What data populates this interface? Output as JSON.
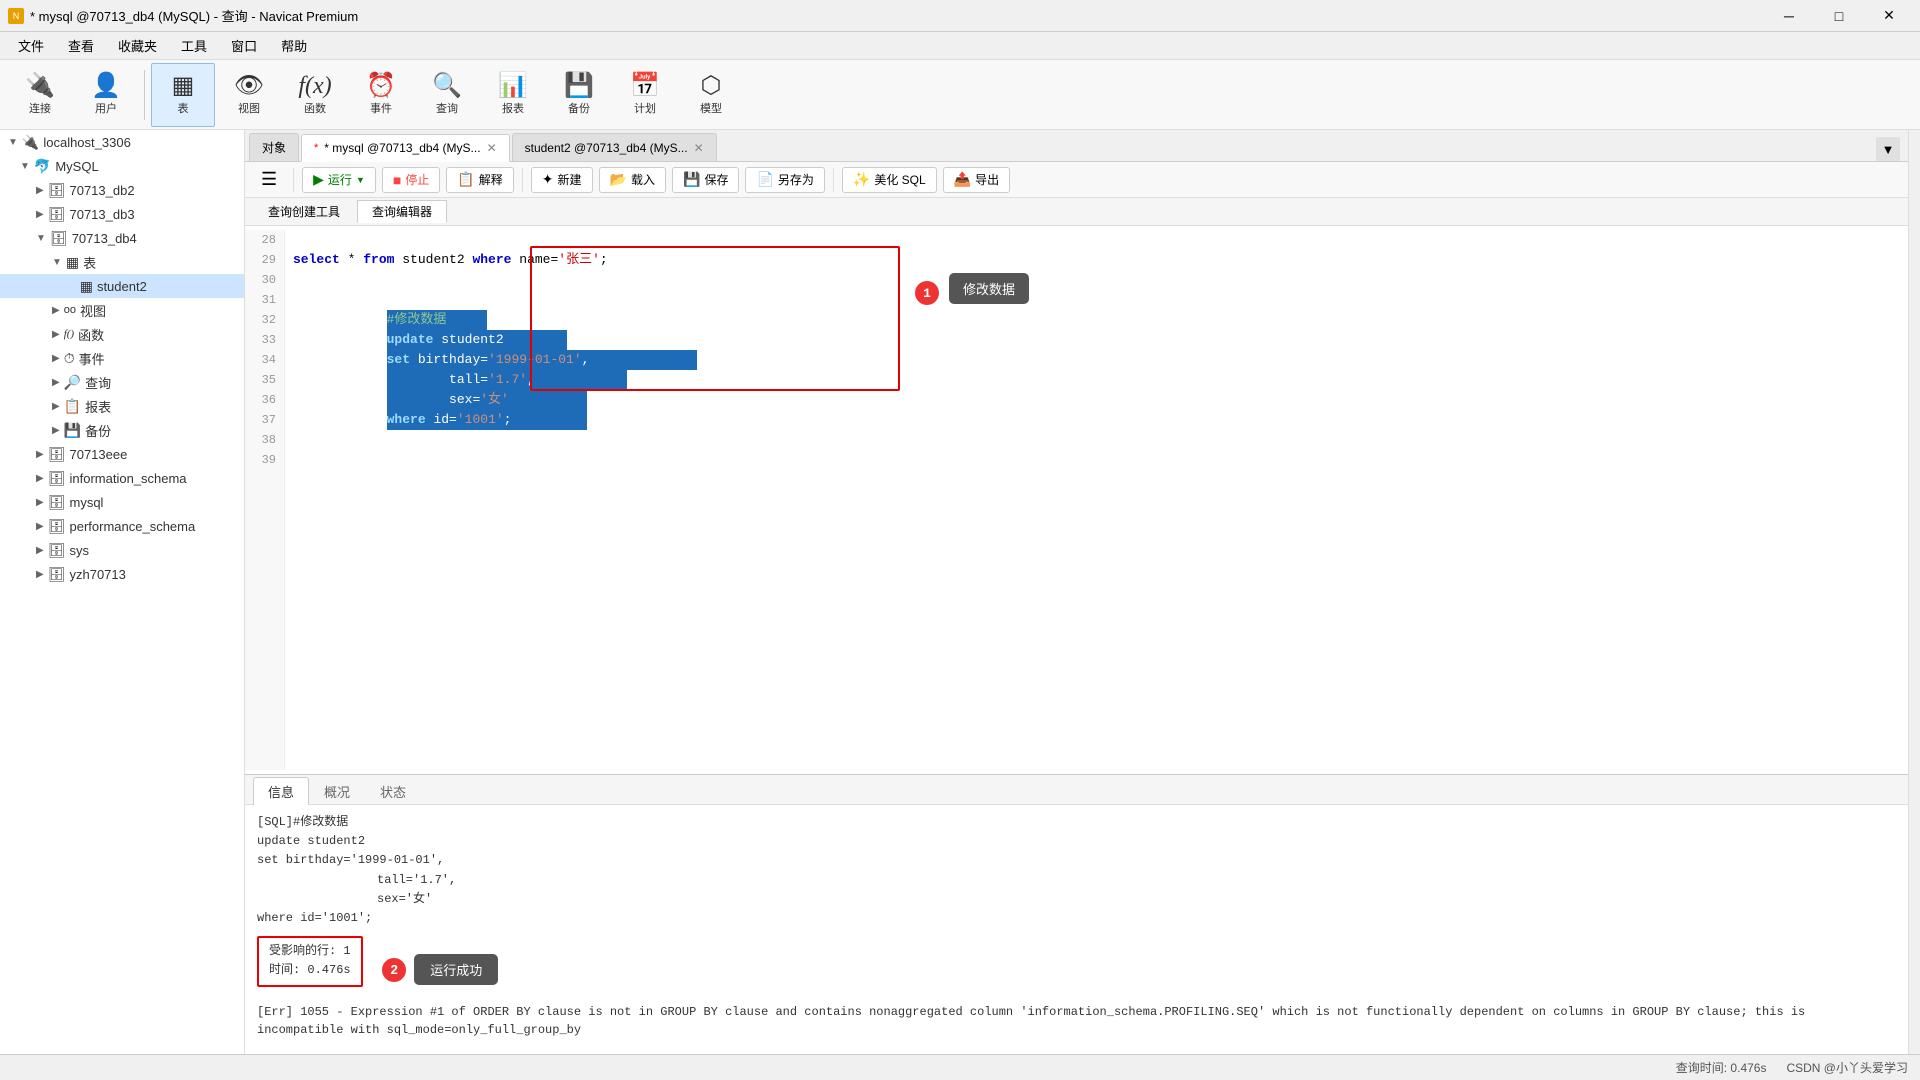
{
  "titlebar": {
    "title": "* mysql @70713_db4 (MySQL) - 查询 - Navicat Premium",
    "icon": "N"
  },
  "menubar": {
    "items": [
      "文件",
      "查看",
      "收藏夹",
      "工具",
      "窗口",
      "帮助"
    ]
  },
  "toolbar": {
    "items": [
      {
        "label": "连接",
        "icon": "🔌"
      },
      {
        "label": "用户",
        "icon": "👤"
      },
      {
        "label": "表",
        "icon": "▦"
      },
      {
        "label": "视图",
        "icon": "👁"
      },
      {
        "label": "函数",
        "icon": "ƒ"
      },
      {
        "label": "事件",
        "icon": "⏰"
      },
      {
        "label": "查询",
        "icon": "🔍"
      },
      {
        "label": "报表",
        "icon": "📊"
      },
      {
        "label": "备份",
        "icon": "💾"
      },
      {
        "label": "计划",
        "icon": "📅"
      },
      {
        "label": "模型",
        "icon": "⬡"
      }
    ]
  },
  "tabs": {
    "object_tab": "对象",
    "query_tab1": "* mysql @70713_db4 (MyS...",
    "query_tab2": "student2 @70713_db4 (MyS..."
  },
  "query_toolbar": {
    "run": "运行",
    "stop": "停止",
    "explain": "解释",
    "new": "新建",
    "load": "载入",
    "save": "保存",
    "save_as": "另存为",
    "beautify": "美化 SQL",
    "export": "导出"
  },
  "query_sub_tabs": {
    "create_tool": "查询创建工具",
    "editor": "查询编辑器"
  },
  "sql_lines": {
    "line28": "",
    "line29": "select * from student2 where name='张三';",
    "line30": "",
    "line31_comment": "#修改数据",
    "line32": "update student2",
    "line33": "set birthday='1999-01-01',",
    "line34": "        tall='1.7',",
    "line35": "        sex='女'",
    "line36": "where id='1001';",
    "line37": "",
    "line38": "",
    "line39": ""
  },
  "annotation1": {
    "badge": "1",
    "label": "修改数据"
  },
  "result_tabs": [
    "信息",
    "概况",
    "状态"
  ],
  "result_active_tab": "信息",
  "result_content": {
    "sql_header": "[SQL]#修改数据",
    "line1": "update student2",
    "line2": "set birthday='1999-01-01',",
    "line3": "tall='1.7',",
    "line4": "sex='女'",
    "line5": "",
    "line6": "where id='1001';",
    "affected": "受影响的行: 1",
    "time": "时间: 0.476s",
    "success_label": "运行成功",
    "error_msg": "[Err] 1055 - Expression #1 of ORDER BY clause is not in GROUP BY clause and contains nonaggregated column 'information_schema.PROFILING.SEQ' which is not functionally dependent on columns in GROUP BY clause; this is incompatible with sql_mode=only_full_group_by"
  },
  "annotation2": {
    "badge": "2"
  },
  "sidebar": {
    "items": [
      {
        "label": "localhost_3306",
        "level": 0,
        "icon": "🔌",
        "expanded": true
      },
      {
        "label": "MySQL",
        "level": 1,
        "icon": "🐬",
        "expanded": true
      },
      {
        "label": "70713_db2",
        "level": 2,
        "icon": "🗄"
      },
      {
        "label": "70713_db3",
        "level": 2,
        "icon": "🗄"
      },
      {
        "label": "70713_db4",
        "level": 2,
        "icon": "🗄",
        "expanded": true
      },
      {
        "label": "表",
        "level": 3,
        "icon": "▦",
        "expanded": true
      },
      {
        "label": "student2",
        "level": 4,
        "icon": "▦",
        "selected": true
      },
      {
        "label": "视图",
        "level": 3,
        "icon": "👁"
      },
      {
        "label": "函数",
        "level": 3,
        "icon": "ƒ"
      },
      {
        "label": "事件",
        "level": 3,
        "icon": "⏰"
      },
      {
        "label": "查询",
        "level": 3,
        "icon": "🔍"
      },
      {
        "label": "报表",
        "level": 3,
        "icon": "📊"
      },
      {
        "label": "备份",
        "level": 3,
        "icon": "💾"
      },
      {
        "label": "70713eee",
        "level": 2,
        "icon": "🗄"
      },
      {
        "label": "information_schema",
        "level": 2,
        "icon": "🗄"
      },
      {
        "label": "mysql",
        "level": 2,
        "icon": "🗄"
      },
      {
        "label": "performance_schema",
        "level": 2,
        "icon": "🗄"
      },
      {
        "label": "sys",
        "level": 2,
        "icon": "🗄"
      },
      {
        "label": "yzh70713",
        "level": 2,
        "icon": "🗄"
      }
    ]
  },
  "statusbar": {
    "query_time": "查询时间: 0.476s",
    "watermark": "CSDN @小丫头爱学习"
  }
}
